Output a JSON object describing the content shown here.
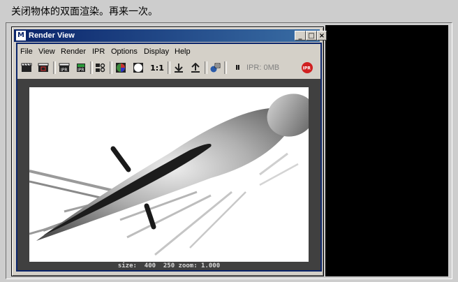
{
  "caption": "关闭物体的双面渲染。再来一次。",
  "window": {
    "title": "Render View",
    "icon_label": "M",
    "minimize_label": "_",
    "maximize_label": "□",
    "close_label": "×"
  },
  "menu": [
    "File",
    "View",
    "Render",
    "IPR",
    "Options",
    "Display",
    "Help"
  ],
  "toolbar": {
    "ratio_label": "1:1",
    "pause_label": "II",
    "ipr_status": "IPR: 0MB",
    "ipr_button_label": "IPR"
  },
  "status": {
    "text": "size:  400  250 zoom: 1.000"
  },
  "colors": {
    "title_start": "#0a246a",
    "title_end": "#3a6ea5",
    "viewport_bg": "#404040",
    "panel_bg": "#000000"
  }
}
